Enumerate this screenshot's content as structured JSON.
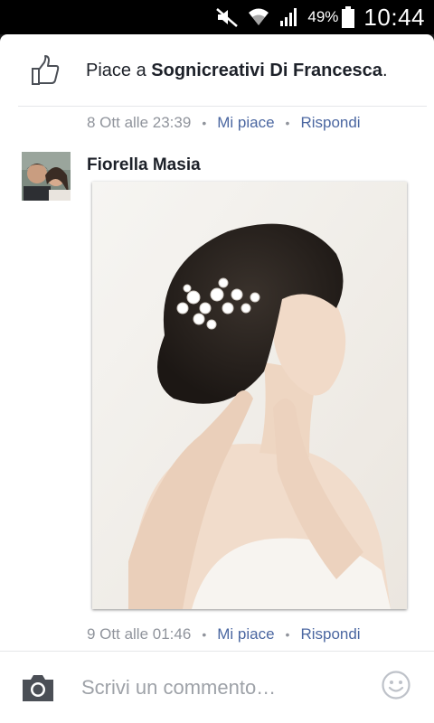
{
  "status_bar": {
    "battery_percent": "49%",
    "time": "10:44",
    "icons": [
      "mute-icon",
      "wifi-icon",
      "signal-icon",
      "battery-icon"
    ]
  },
  "likes": {
    "prefix": "Piace a ",
    "page_name": "Sognicreativi Di Francesca",
    "suffix": ".",
    "icon": "thumbs-up-icon"
  },
  "post_meta": {
    "timestamp": "8 Ott alle 23:39",
    "like_label": "Mi piace",
    "reply_label": "Rispondi"
  },
  "comment": {
    "author": "Fiorella Masia",
    "timestamp": "9 Ott alle 01:46",
    "like_label": "Mi piace",
    "reply_label": "Rispondi"
  },
  "composer": {
    "placeholder": "Scrivi un commento…",
    "camera_icon": "camera-icon",
    "emoji_icon": "smiley-icon"
  },
  "colors": {
    "link": "#4b67a1",
    "meta_text": "#90949c",
    "primary_text": "#1d2129",
    "divider": "#e5e6e9"
  }
}
